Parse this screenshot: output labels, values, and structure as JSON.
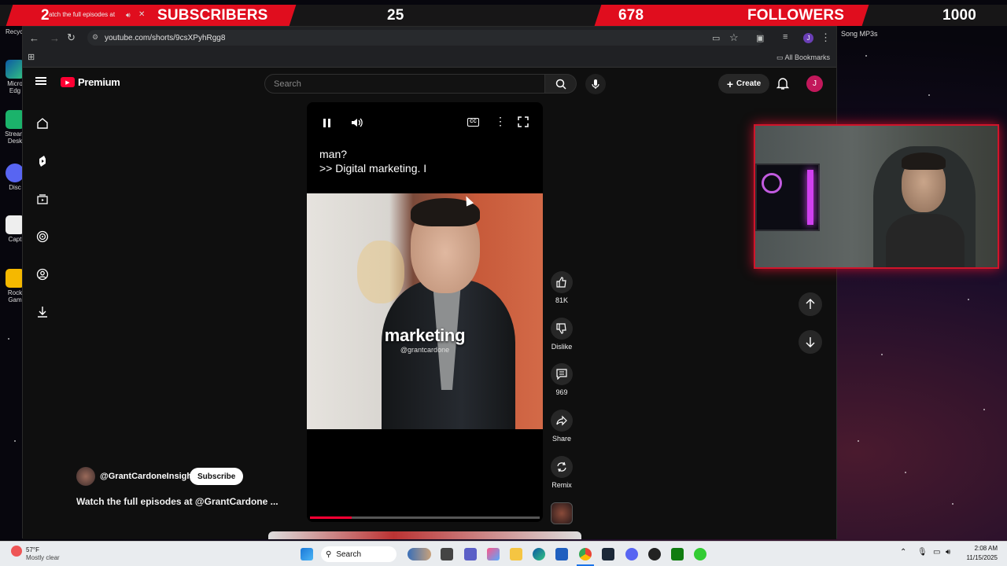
{
  "banner": {
    "count_left": "2",
    "subscribers_label": "SUBSCRIBERS",
    "subscribers_goal": "25",
    "followers_count": "678",
    "followers_label": "FOLLOWERS",
    "followers_goal": "1000",
    "tab_title": "atch the full episodes at"
  },
  "desktop": {
    "items": [
      "Recycl",
      "Micro Edg",
      "Stream Desk",
      "Disc",
      "Capt",
      "Rock Gam"
    ],
    "right_item": "Song MP3s"
  },
  "browser": {
    "url": "youtube.com/shorts/9csXPyhRgg8",
    "bookmarks_label": "All Bookmarks",
    "profile_initial": "J"
  },
  "youtube": {
    "logo_text": "Premium",
    "search_placeholder": "Search",
    "create_label": "Create",
    "avatar_initial": "J",
    "captions": {
      "line1": "man?",
      "line2": ">> Digital marketing. I"
    },
    "overlay_text": "marketing",
    "overlay_handle": "@grantcardone",
    "actions": {
      "likes": "81K",
      "dislike": "Dislike",
      "comments": "969",
      "share": "Share",
      "remix": "Remix"
    },
    "channel": "@GrantCardoneInsight",
    "subscribe_label": "Subscribe",
    "description": "Watch the full episodes at @GrantCardone ...",
    "progress": 0.18
  },
  "taskbar": {
    "temp": "57°F",
    "weather": "Mostly clear",
    "search_label": "Search",
    "time": "2:08 AM",
    "date": "11/15/2025"
  },
  "colors": {
    "banner_red": "#e00d1e",
    "yt_red": "#ff0033",
    "cam_border": "#d0142a"
  }
}
